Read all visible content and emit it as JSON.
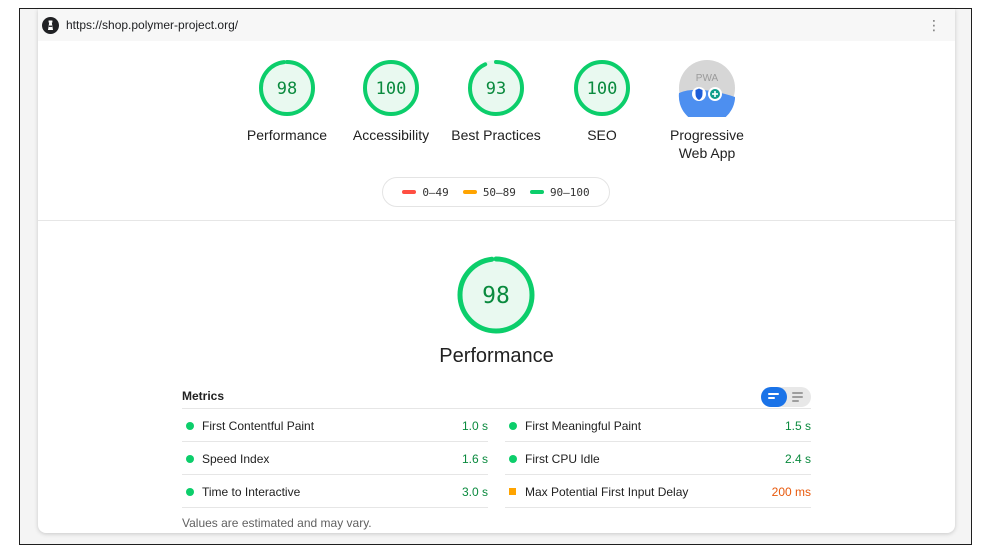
{
  "topbar": {
    "url": "https://shop.polymer-project.org/",
    "menu_glyph": "⋮"
  },
  "colors": {
    "pass": "#0cce6b",
    "average": "#ffa400",
    "fail": "#ff4e42",
    "pass_text": "#0a8a3e",
    "average_text": "#e8590c",
    "accent": "#1a73e8"
  },
  "categories": [
    {
      "score": "98",
      "label": "Performance",
      "level": 0.98
    },
    {
      "score": "100",
      "label": "Accessibility",
      "level": 1.0
    },
    {
      "score": "93",
      "label": "Best Practices",
      "level": 0.93
    },
    {
      "score": "100",
      "label": "SEO",
      "level": 1.0
    }
  ],
  "pwa": {
    "badge": "PWA",
    "label_line1": "Progressive",
    "label_line2": "Web App",
    "icon": "pwa-badge-icon"
  },
  "legend": [
    {
      "range": "0–49",
      "color": "#ff4e42"
    },
    {
      "range": "50–89",
      "color": "#ffa400"
    },
    {
      "range": "90–100",
      "color": "#0cce6b"
    }
  ],
  "main": {
    "score": "98",
    "title": "Performance",
    "level": 0.98
  },
  "metrics": {
    "title": "Metrics",
    "left": [
      {
        "name": "First Contentful Paint",
        "value": "1.0 s",
        "status": "pass"
      },
      {
        "name": "Speed Index",
        "value": "1.6 s",
        "status": "pass"
      },
      {
        "name": "Time to Interactive",
        "value": "3.0 s",
        "status": "pass"
      }
    ],
    "right": [
      {
        "name": "First Meaningful Paint",
        "value": "1.5 s",
        "status": "pass"
      },
      {
        "name": "First CPU Idle",
        "value": "2.4 s",
        "status": "pass"
      },
      {
        "name": "Max Potential First Input Delay",
        "value": "200 ms",
        "status": "average"
      }
    ]
  },
  "footnote": "Values are estimated and may vary."
}
